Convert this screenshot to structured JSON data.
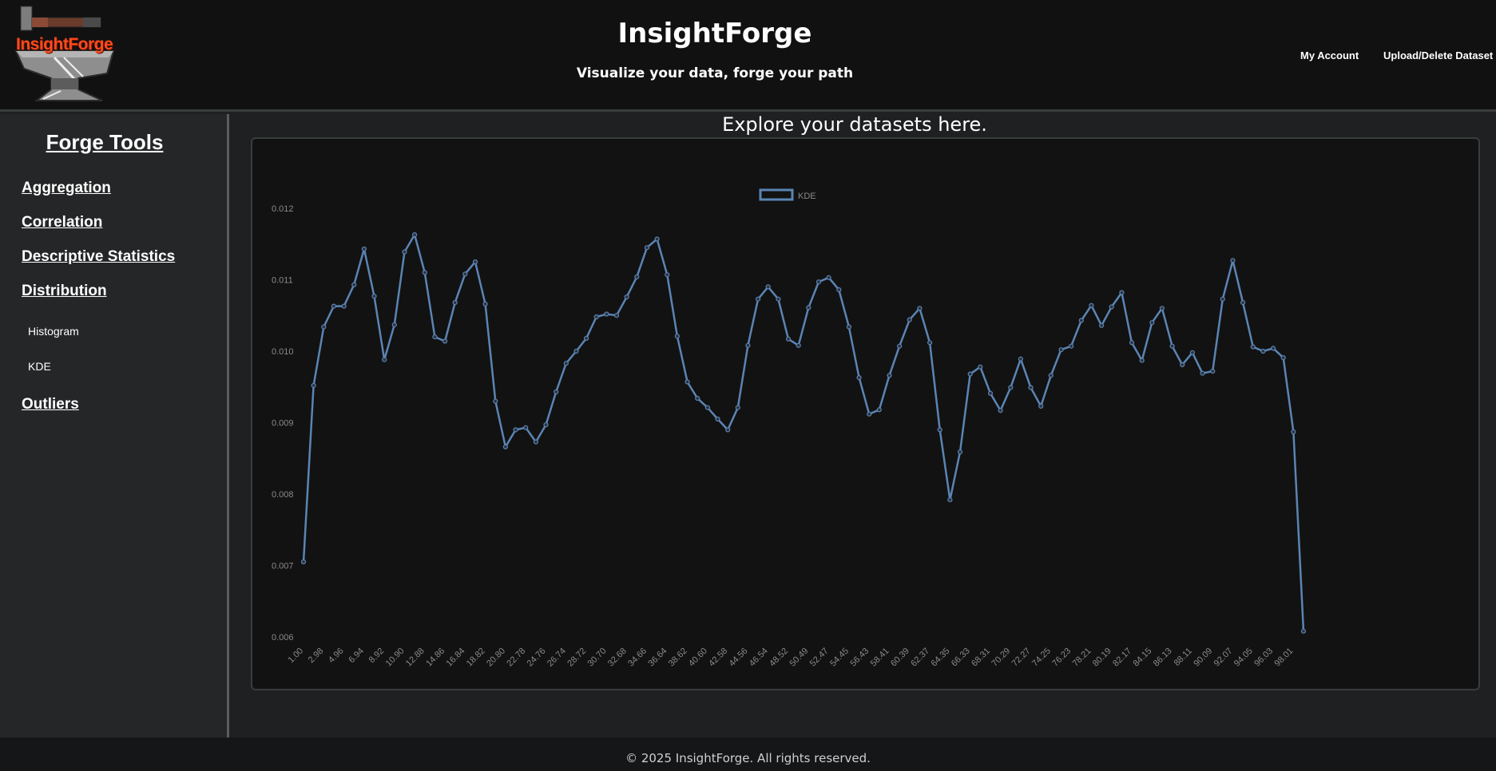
{
  "header": {
    "logo_text": "InsightForge",
    "title": "InsightForge",
    "tagline": "Visualize your data, forge your path",
    "nav": [
      "My Account",
      "Upload/Delete Dataset"
    ]
  },
  "sidebar": {
    "title": "Forge Tools",
    "tools": [
      "Aggregation",
      "Correlation",
      "Descriptive Statistics",
      "Distribution"
    ],
    "distribution_items": [
      "Histogram",
      "KDE"
    ],
    "outliers": "Outliers"
  },
  "main": {
    "heading": "Explore your datasets here."
  },
  "footer": {
    "text": "© 2025 InsightForge. All rights reserved."
  },
  "colors": {
    "line": "#5b84b4",
    "accent_logo": "#ff4a1c"
  },
  "chart_data": {
    "type": "line",
    "legend": "KDE",
    "legend_position": "top-center",
    "grid": false,
    "ylim": [
      0.006,
      0.012
    ],
    "yticks": [
      "0.012",
      "0.011",
      "0.010",
      "0.009",
      "0.008",
      "0.007",
      "0.006"
    ],
    "xtick_labels": [
      "1.00",
      "2.98",
      "4.96",
      "6.94",
      "8.92",
      "10.90",
      "12.88",
      "14.86",
      "16.84",
      "18.82",
      "20.80",
      "22.78",
      "24.76",
      "26.74",
      "28.72",
      "30.70",
      "32.68",
      "34.66",
      "36.64",
      "38.62",
      "40.60",
      "42.58",
      "44.56",
      "46.54",
      "48.52",
      "50.49",
      "52.47",
      "54.45",
      "56.43",
      "58.41",
      "60.39",
      "62.37",
      "64.35",
      "66.33",
      "68.31",
      "70.29",
      "72.27",
      "74.25",
      "76.23",
      "78.21",
      "80.19",
      "82.17",
      "84.15",
      "86.13",
      "88.11",
      "90.09",
      "92.07",
      "94.05",
      "96.03",
      "98.01"
    ],
    "values": [
      0.00705,
      0.00952,
      0.01034,
      0.01063,
      0.01063,
      0.01093,
      0.01143,
      0.01077,
      0.00988,
      0.01037,
      0.01139,
      0.01163,
      0.0111,
      0.0102,
      0.01014,
      0.01068,
      0.01108,
      0.01125,
      0.01066,
      0.0093,
      0.00866,
      0.0089,
      0.00893,
      0.00873,
      0.00897,
      0.00943,
      0.00983,
      0.01,
      0.01018,
      0.01048,
      0.01052,
      0.0105,
      0.01076,
      0.01104,
      0.01145,
      0.01157,
      0.01107,
      0.01021,
      0.00957,
      0.00934,
      0.00921,
      0.00905,
      0.0089,
      0.00921,
      0.01008,
      0.01073,
      0.0109,
      0.01073,
      0.01017,
      0.01008,
      0.01061,
      0.01097,
      0.01103,
      0.01086,
      0.01034,
      0.00963,
      0.00912,
      0.00918,
      0.00966,
      0.01007,
      0.01044,
      0.0106,
      0.01012,
      0.0089,
      0.00792,
      0.00859,
      0.00968,
      0.00978,
      0.00941,
      0.00917,
      0.00949,
      0.00989,
      0.00949,
      0.00923,
      0.00966,
      0.01002,
      0.01007,
      0.01043,
      0.01064,
      0.01036,
      0.01062,
      0.01082,
      0.01012,
      0.00987,
      0.0104,
      0.0106,
      0.01007,
      0.00981,
      0.00998,
      0.00969,
      0.00972,
      0.01073,
      0.01127,
      0.01068,
      0.01006,
      0.01,
      0.01004,
      0.00991,
      0.00887,
      0.00608
    ]
  }
}
